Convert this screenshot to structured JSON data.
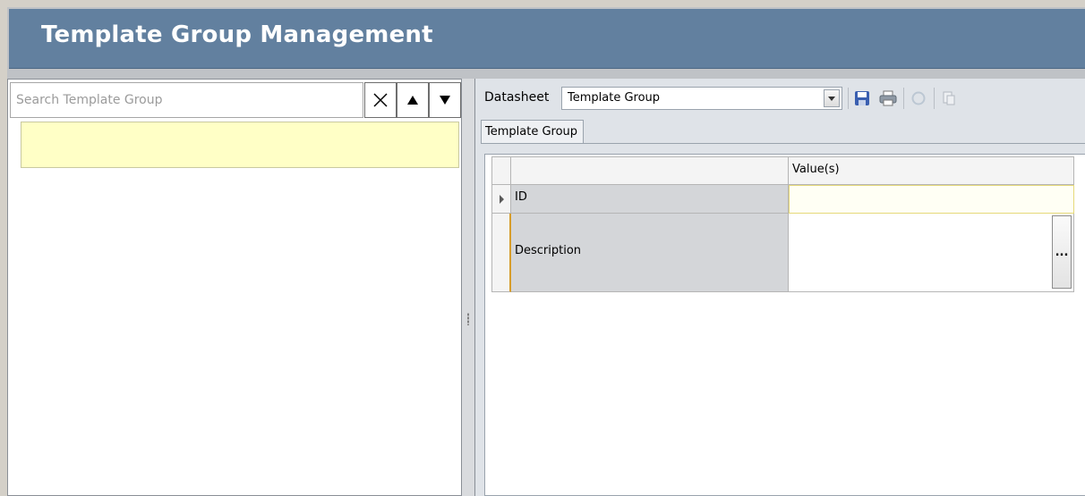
{
  "header": {
    "title": "Template Group Management"
  },
  "left_panel": {
    "search": {
      "placeholder": "Search Template Group",
      "value": ""
    },
    "buttons": {
      "clear": "✕",
      "up": "▲",
      "down": "▼"
    }
  },
  "right_panel": {
    "toolbar": {
      "datasheet_label": "Datasheet",
      "datasheet_selected": "Template Group",
      "icons": [
        "save-icon",
        "print-icon",
        "disabled-icon",
        "copy-icon"
      ]
    },
    "tabs": [
      {
        "label": "Template Group"
      }
    ],
    "grid": {
      "header": {
        "value_col": "Value(s)"
      },
      "rows": [
        {
          "field": "ID",
          "value": ""
        },
        {
          "field": "Description",
          "value": "",
          "button": "..."
        }
      ]
    }
  },
  "colors": {
    "header_bg": "#62809f",
    "selected_item_bg": "#ffffc6",
    "field_cell_bg": "#d4d6d9"
  }
}
